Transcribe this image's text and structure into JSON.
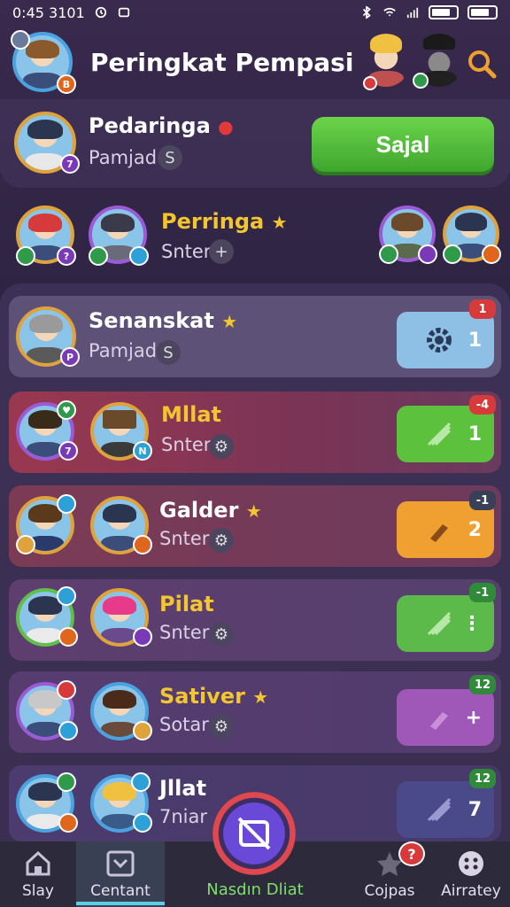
{
  "status_bar": {
    "time": "0:45 3101"
  },
  "header": {
    "title": "Peringkat Pempasi"
  },
  "top_player": {
    "name": "Pedaringa",
    "sub": "Pamjad",
    "chip": "S",
    "level": "7",
    "action_label": "Sajal"
  },
  "second_section": {
    "name": "Perringa",
    "sub": "Snter",
    "chip": "+"
  },
  "rows": [
    {
      "name": "Senanskat",
      "sub": "Pamjad",
      "chip": "S",
      "badge": "1",
      "count": "1",
      "name_color": "#ffffff",
      "btn_color": "#8ec0e6",
      "notif_color": "#d63a3a"
    },
    {
      "name": "Mllat",
      "sub": "Snter",
      "chip": "⚙",
      "badge": "-4",
      "count": "1",
      "name_color": "#f2c531",
      "btn_color": "#5cc23e",
      "notif_color": "#d63a3a"
    },
    {
      "name": "Galder",
      "sub": "Snter",
      "chip": "⚙",
      "badge": "-1",
      "count": "2",
      "name_color": "#ffffff",
      "btn_color": "#f0a030",
      "notif_color": "#3a3f58"
    },
    {
      "name": "Pilat",
      "sub": "Snter",
      "chip": "⚙",
      "badge": "-1",
      "count": "⋮",
      "name_color": "#f2c531",
      "btn_color": "#5cba4a",
      "notif_color": "#2f8a3a"
    },
    {
      "name": "Sativer",
      "sub": "Sotar",
      "chip": "⚙",
      "badge": "12",
      "count": "+",
      "name_color": "#f2c531",
      "btn_color": "#a058b8",
      "notif_color": "#2f8a3a"
    },
    {
      "name": "Jllat",
      "sub": "7niar",
      "chip": "",
      "badge": "12",
      "count": "7",
      "name_color": "#ffffff",
      "btn_color": "#4a4a8a",
      "notif_color": "#2f8a3a"
    }
  ],
  "nav": {
    "items": [
      {
        "label": "Slay",
        "icon": "home-icon"
      },
      {
        "label": "Centant",
        "icon": "chevron-box-icon"
      },
      {
        "label": "Nasdın Dliat",
        "icon": "center-action-icon"
      },
      {
        "label": "Cojpas",
        "icon": "star-icon",
        "badge": "?"
      },
      {
        "label": "Airratey",
        "icon": "dots-icon"
      }
    ]
  },
  "colors": {
    "accent_green": "#5cc23e",
    "star": "#f2c531",
    "nav_active": "#5ad0e6"
  }
}
